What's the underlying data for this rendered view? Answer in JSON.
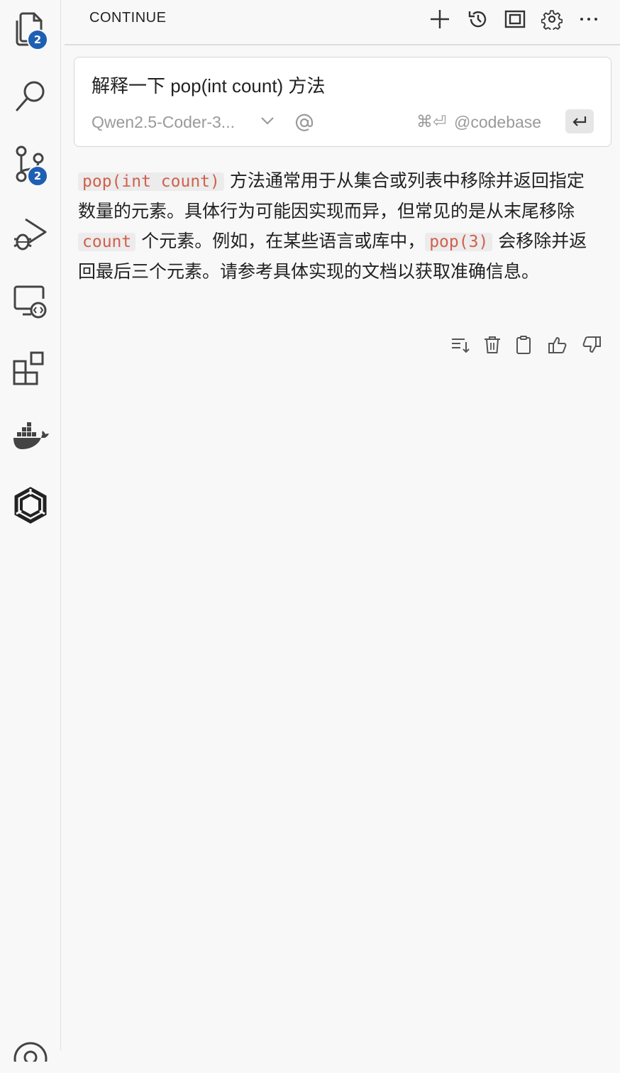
{
  "activity_bar": {
    "explorer_badge": "2",
    "source_control_badge": "2"
  },
  "header": {
    "title": "CONTINUE",
    "icons": [
      "plus-icon",
      "history-icon",
      "fullscreen-icon",
      "gear-icon",
      "more-icon"
    ]
  },
  "input": {
    "prompt": "解释一下 pop(int count) 方法",
    "model": "Qwen2.5-Coder-3...",
    "shortcut": "⌘⏎",
    "codebase": "@codebase"
  },
  "response": {
    "code1": "pop(int count)",
    "text1": " 方法通常用于从集合或列表中移除并返回指定数量的元素。具体行为可能因实现而异，但常见的是从末尾移除 ",
    "code2": "count",
    "text2": " 个元素。例如，在某些语言或库中，",
    "code3": "pop(3)",
    "text3": " 会移除并返回最后三个元素。请参考具体实现的文档以获取准确信息。"
  },
  "colors": {
    "badge": "#1e5fb4",
    "code_text": "#d0604d",
    "background": "#f8f8f8"
  }
}
